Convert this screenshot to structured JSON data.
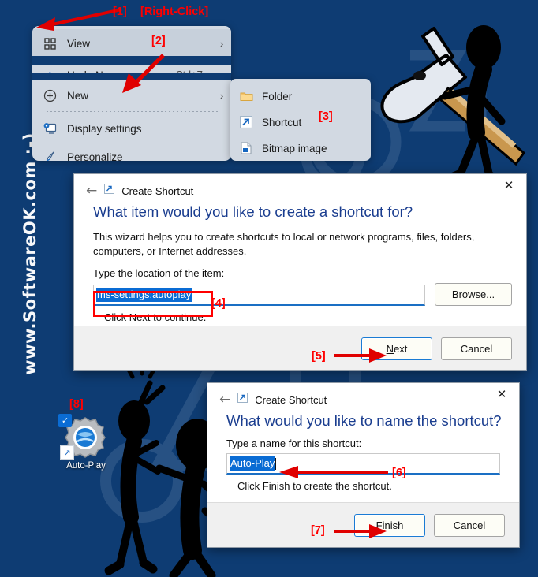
{
  "watermark": {
    "text": "www.SoftwareOK.com :-)"
  },
  "context_menu": {
    "items": [
      {
        "label": "View",
        "accel": "",
        "icon": "grid-icon",
        "chevron": "›"
      },
      {
        "label": "Undo New",
        "accel": "Ctrl+Z",
        "icon": "undo-icon",
        "chevron": ""
      },
      {
        "label": "New",
        "accel": "",
        "icon": "plus-circle-icon",
        "chevron": "›"
      },
      {
        "label": "Display settings",
        "accel": "",
        "icon": "display-icon",
        "chevron": ""
      },
      {
        "label": "Personalize",
        "accel": "",
        "icon": "brush-icon",
        "chevron": ""
      }
    ]
  },
  "submenu": {
    "items": [
      {
        "label": "Folder",
        "icon": "folder-icon"
      },
      {
        "label": "Shortcut",
        "icon": "shortcut-arrow-icon"
      },
      {
        "label": "Bitmap image",
        "icon": "bitmap-image-icon"
      }
    ]
  },
  "dialog1": {
    "title": "Create Shortcut",
    "heading": "What item would you like to create a shortcut for?",
    "body": "This wizard helps you to create shortcuts to local or network programs, files, folders, computers, or Internet addresses.",
    "field_label": "Type the location of the item:",
    "field_value": "ms-settings:autoplay",
    "browse_label": "Browse...",
    "hint": "Click Next to continue.",
    "next_label": "Next",
    "next_accel": "N",
    "cancel_label": "Cancel",
    "close_icon": "close-icon",
    "back_icon": "back-arrow-icon"
  },
  "dialog2": {
    "title": "Create Shortcut",
    "heading": "What would you like to name the shortcut?",
    "field_label": "Type a name for this shortcut:",
    "field_value": "Auto-Play",
    "hint": "Click Finish to create the shortcut.",
    "finish_label": "Finish",
    "finish_accel": "F",
    "cancel_label": "Cancel",
    "close_icon": "close-icon",
    "back_icon": "back-arrow-icon"
  },
  "desktop_icon": {
    "label": "Auto-Play",
    "icon": "autoplay-gear-icon",
    "badge": "check-badge-icon",
    "overlay": "shortcut-arrow-overlay-icon"
  },
  "annotations": {
    "step1": "[1]",
    "step1_note": "[Right-Click]",
    "step2": "[2]",
    "step3": "[3]",
    "step4": "[4]",
    "step5": "[5]",
    "step6": "[6]",
    "step7": "[7]",
    "step8": "[8]"
  },
  "colors": {
    "desktop": "#0e3c73",
    "menu": "#d2d9e2",
    "accent": "#ff0000",
    "heading": "#1a3d8f",
    "selection": "#0a6cd4"
  }
}
